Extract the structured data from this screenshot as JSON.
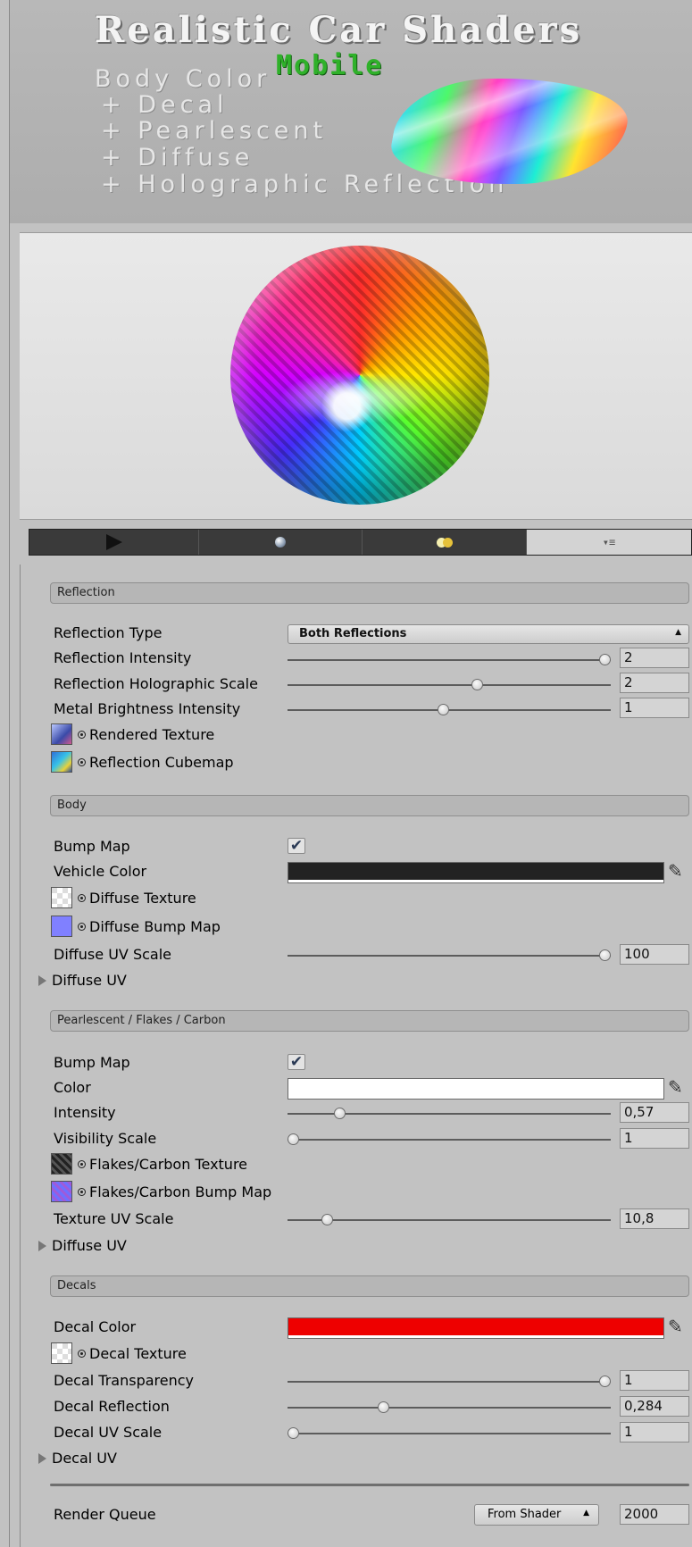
{
  "banner": {
    "title": "Realistic Car Shaders",
    "subtitle": "Mobile",
    "lines": [
      "Body Color",
      "+ Decal",
      "+ Pearlescent",
      "+ Diffuse",
      "+ Holographic Reflection"
    ]
  },
  "toolbar": {
    "icons": [
      "play-icon",
      "sphere-preview-icon",
      "lights-icon",
      "menu-icon"
    ],
    "menu_glyph": "▾≡"
  },
  "reflection": {
    "header": "Reflection",
    "type_label": "Reflection Type",
    "type_value": "Both Reflections",
    "intensity_label": "Reflection Intensity",
    "intensity_value": "2",
    "intensity_fraction": 1.0,
    "holo_label": "Reflection Holographic Scale",
    "holo_value": "2",
    "holo_fraction": 0.59,
    "metal_label": "Metal Brightness Intensity",
    "metal_value": "1",
    "metal_fraction": 0.48,
    "rendered_texture_label": "Rendered Texture",
    "cubemap_label": "Reflection Cubemap"
  },
  "body": {
    "header": "Body",
    "bump_label": "Bump Map",
    "bump_checked": "✔",
    "vehicle_color_label": "Vehicle Color",
    "vehicle_color": "#222222",
    "diffuse_texture_label": "Diffuse Texture",
    "diffuse_bump_label": "Diffuse Bump Map",
    "uv_scale_label": "Diffuse UV Scale",
    "uv_scale_value": "100",
    "uv_scale_fraction": 1.0,
    "foldout_label": "Diffuse UV"
  },
  "pearl": {
    "header": "Pearlescent / Flakes / Carbon",
    "bump_label": "Bump Map",
    "bump_checked": "✔",
    "color_label": "Color",
    "color": "#ffffff",
    "intensity_label": "Intensity",
    "intensity_value": "0,57",
    "intensity_fraction": 0.15,
    "visibility_label": "Visibility Scale",
    "visibility_value": "1",
    "visibility_fraction": 0.0,
    "flakes_texture_label": "Flakes/Carbon Texture",
    "flakes_bump_label": "Flakes/Carbon Bump Map",
    "uv_scale_label": "Texture UV Scale",
    "uv_scale_value": "10,8",
    "uv_scale_fraction": 0.11,
    "foldout_label": "Diffuse UV"
  },
  "decals": {
    "header": "Decals",
    "color_label": "Decal Color",
    "color": "#ee0000",
    "texture_label": "Decal Texture",
    "transparency_label": "Decal Transparency",
    "transparency_value": "1",
    "transparency_fraction": 1.0,
    "reflection_label": "Decal Reflection",
    "reflection_value": "0,284",
    "reflection_fraction": 0.29,
    "uv_scale_label": "Decal UV Scale",
    "uv_scale_value": "1",
    "uv_scale_fraction": 0.0,
    "foldout_label": "Decal UV"
  },
  "render_queue": {
    "label": "Render Queue",
    "mode": "From Shader",
    "value": "2000"
  },
  "colors": {
    "background": "#c2c2c2",
    "section_header": "#b6b6b6",
    "toolbar": "#3a3a3a"
  }
}
